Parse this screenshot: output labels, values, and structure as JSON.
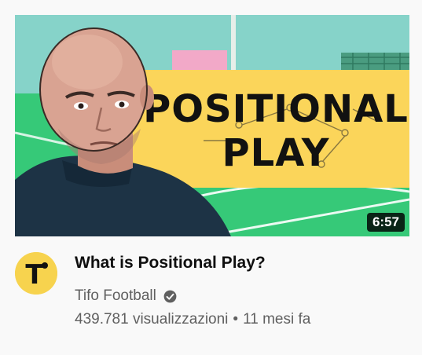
{
  "thumbnail": {
    "headline_line1": "POSITIONAL",
    "headline_line2": "PLAY",
    "duration": "6:57",
    "colors": {
      "sky": "#86d3c9",
      "pitch": "#36c978",
      "banner": "#fbd55a",
      "text": "#111111"
    }
  },
  "channel": {
    "avatar_letter": "T",
    "avatar_color": "#f7d34e",
    "name": "Tifo Football",
    "verified_icon": "verified-check-icon"
  },
  "video": {
    "title": "What is Positional Play?",
    "views": "439.781 visualizzazioni",
    "separator": "•",
    "age": "11 mesi fa"
  }
}
